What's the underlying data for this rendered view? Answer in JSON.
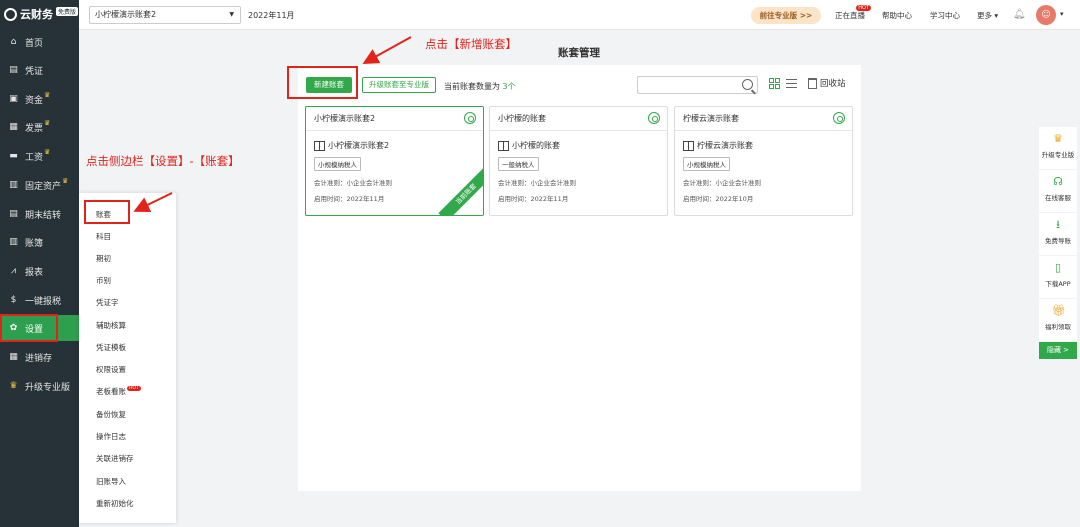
{
  "app": {
    "logo": "云财务",
    "logo_badge": "免费版"
  },
  "sidebar": {
    "items": [
      {
        "label": "首页",
        "icon": "home-icon",
        "crown": false
      },
      {
        "label": "凭证",
        "icon": "voucher-icon",
        "crown": false
      },
      {
        "label": "资金",
        "icon": "fund-icon",
        "crown": true
      },
      {
        "label": "发票",
        "icon": "invoice-icon",
        "crown": true
      },
      {
        "label": "工资",
        "icon": "salary-icon",
        "crown": true
      },
      {
        "label": "固定资产",
        "icon": "asset-icon",
        "crown": true
      },
      {
        "label": "期末结转",
        "icon": "period-close-icon",
        "crown": false
      },
      {
        "label": "账簿",
        "icon": "ledger-icon",
        "crown": false
      },
      {
        "label": "报表",
        "icon": "report-icon",
        "crown": false
      },
      {
        "label": "一键报税",
        "icon": "tax-icon",
        "crown": false
      },
      {
        "label": "设置",
        "icon": "settings-icon",
        "crown": false,
        "active": true
      },
      {
        "label": "进销存",
        "icon": "inventory-icon",
        "crown": false
      },
      {
        "label": "升级专业版",
        "icon": "crown-icon",
        "crown": false
      }
    ]
  },
  "topbar": {
    "account_select": "小柠檬演示账套2",
    "period": "2022年11月",
    "pro_button": "前往专业版 >>",
    "live": "正在直播",
    "live_badge": "HOT",
    "help": "帮助中心",
    "learn": "学习中心",
    "more": "更多",
    "more_caret": "▾",
    "avatar_caret": "▾"
  },
  "main": {
    "page_title": "账套管理",
    "new_button": "新建账套",
    "upgrade_button": "升级账套至专业版",
    "count_prefix": "当前账套数量为",
    "count_value": "3个",
    "recycle": "回收站",
    "search_placeholder": ""
  },
  "cards": [
    {
      "header": "小柠檬演示账套2",
      "name": "小柠檬演示账套2",
      "tag": "小规模纳税人",
      "standard": "会计准则：小企业会计准则",
      "start": "启用时间：2022年11月",
      "current": true,
      "ribbon": "当前账套"
    },
    {
      "header": "小柠檬的账套",
      "name": "小柠檬的账套",
      "tag": "一般纳税人",
      "standard": "会计准则：小企业会计准则",
      "start": "启用时间：2022年11月",
      "current": false
    },
    {
      "header": "柠檬云演示账套",
      "name": "柠檬云演示账套",
      "tag": "小规模纳税人",
      "standard": "会计准则：小企业会计准则",
      "start": "启用时间：2022年10月",
      "current": false
    }
  ],
  "submenu": {
    "items": [
      "账套",
      "科目",
      "期初",
      "币别",
      "凭证字",
      "辅助核算",
      "凭证模板",
      "权限设置",
      "老板看账",
      "备份恢复",
      "操作日志",
      "关联进销存",
      "旧账导入",
      "重新初始化"
    ],
    "hot_badge": "HOT"
  },
  "annotations": {
    "click_new": "点击【新增账套】",
    "click_sidebar": "点击侧边栏【设置】-【账套】"
  },
  "rightbar": {
    "items": [
      "升级专业版",
      "在线客服",
      "免费导账",
      "下载APP",
      "福利领取"
    ],
    "hide": "隐藏 >"
  },
  "colors": {
    "sidebar": "#263238",
    "active": "#2e9e4f",
    "green": "#31a94a",
    "annotation": "#e2231a"
  }
}
